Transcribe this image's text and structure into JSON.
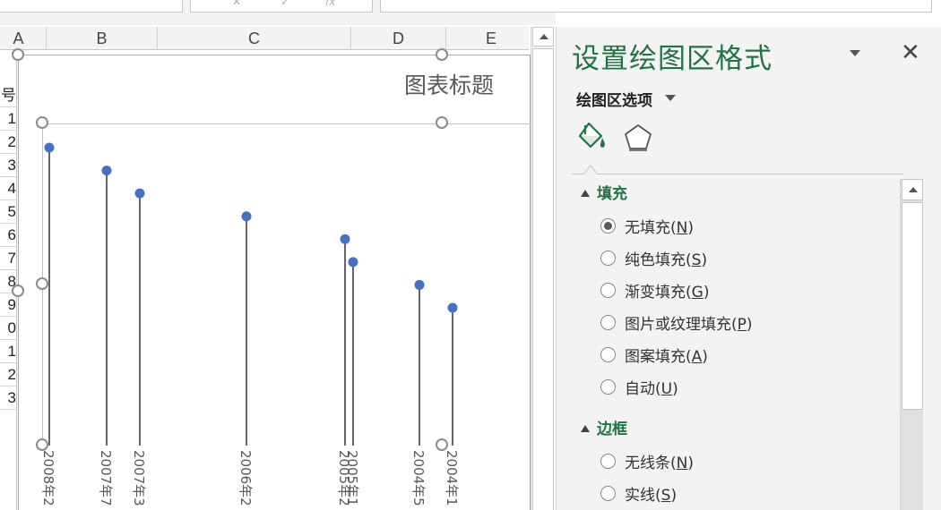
{
  "formula_bar": {
    "fx_symbols": [
      "✕",
      "✓",
      "fx"
    ]
  },
  "columns": [
    "A",
    "B",
    "C",
    "D",
    "E"
  ],
  "row_headers": [
    "号",
    "1",
    "2",
    "3",
    "4",
    "5",
    "6",
    "7",
    "8",
    "9",
    "0",
    "1",
    "2",
    "3"
  ],
  "chart": {
    "title": "图表标题"
  },
  "chart_data": {
    "type": "scatter",
    "title": "图表标题",
    "style": "drop-lines",
    "x": [
      "2008年2",
      "2007年7",
      "2007年3",
      "2006年2",
      "2005年2",
      "2005年1",
      "2004年5",
      "2004年1"
    ],
    "y": [
      100,
      93,
      86,
      79,
      72,
      65,
      58,
      51
    ],
    "x_tick_labels": [
      "2008年2",
      "2007年7",
      "2007年3",
      "2006年2",
      "2005年2",
      "2005年1",
      "2004年5",
      "2004年1"
    ],
    "marker_color": "#4472c4",
    "line_color": "#404040"
  },
  "pane": {
    "title": "设置绘图区格式",
    "options_label": "绘图区选项",
    "fill_tab_icon": "paint-bucket-icon",
    "border_tab_icon": "pentagon-icon",
    "accent": "#217346",
    "sections": [
      {
        "label": "填充",
        "options": [
          {
            "text": "无填充(",
            "key": "N",
            "checked": true
          },
          {
            "text": "纯色填充(",
            "key": "S",
            "checked": false
          },
          {
            "text": "渐变填充(",
            "key": "G",
            "checked": false
          },
          {
            "text": "图片或纹理填充(",
            "key": "P",
            "checked": false
          },
          {
            "text": "图案填充(",
            "key": "A",
            "checked": false
          },
          {
            "text": "自动(",
            "key": "U",
            "checked": false
          }
        ]
      },
      {
        "label": "边框",
        "options": [
          {
            "text": "无线条(",
            "key": "N",
            "checked": false
          },
          {
            "text": "实线(",
            "key": "S",
            "checked": false
          }
        ]
      }
    ]
  }
}
